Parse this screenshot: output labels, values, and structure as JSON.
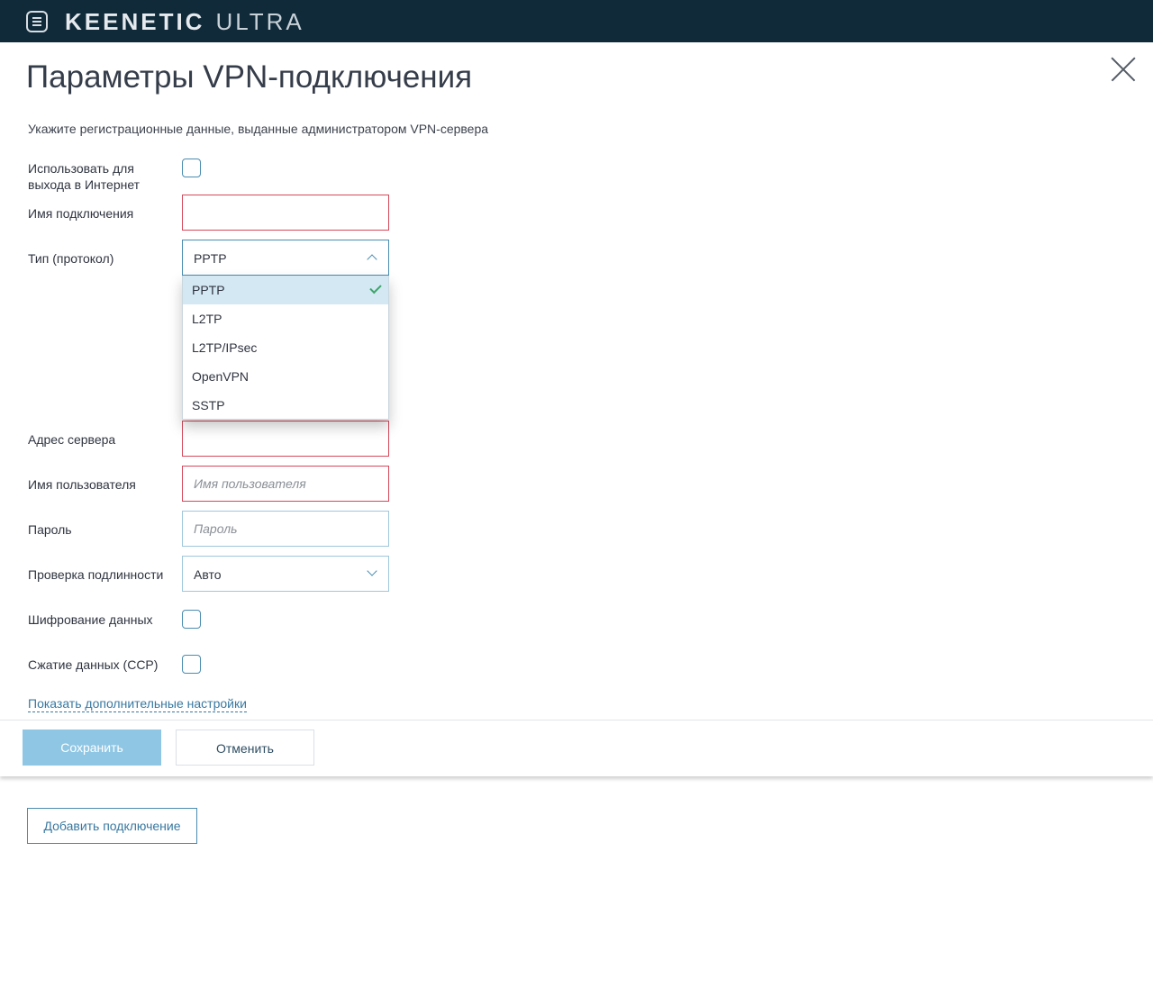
{
  "header": {
    "brand_primary": "KEENETIC",
    "brand_secondary": "ULTRA",
    "menu_icon": "menu-icon"
  },
  "dialog": {
    "title": "Параметры VPN-подключения",
    "subtitle": "Укажите регистрационные данные, выданные администратором VPN-сервера",
    "close_icon": "close-icon"
  },
  "form": {
    "use_for_internet_label": "Использовать для выхода в Интернет",
    "connection_name_label": "Имя подключения",
    "connection_name_value": "",
    "type_label": "Тип (протокол)",
    "type_selected": "PPTP",
    "type_options": [
      "PPTP",
      "L2TP",
      "L2TP/IPsec",
      "OpenVPN",
      "SSTP"
    ],
    "server_address_label": "Адрес сервера",
    "server_address_value": "",
    "username_label": "Имя пользователя",
    "username_placeholder": "Имя пользователя",
    "password_label": "Пароль",
    "password_placeholder": "Пароль",
    "auth_label": "Проверка подлинности",
    "auth_selected": "Авто",
    "encryption_label": "Шифрование данных",
    "compression_label": "Сжатие данных (CCP)",
    "show_more_link": "Показать дополнительные настройки"
  },
  "actions": {
    "save_label": "Сохранить",
    "cancel_label": "Отменить"
  },
  "page": {
    "add_connection_label": "Добавить подключение"
  },
  "colors": {
    "header_bg": "#102a3a",
    "accent": "#4a8cb0",
    "error": "#d6485b",
    "save_button": "#8fc6e4",
    "selected_option": "#d4e8f4",
    "check": "#3da56b"
  }
}
